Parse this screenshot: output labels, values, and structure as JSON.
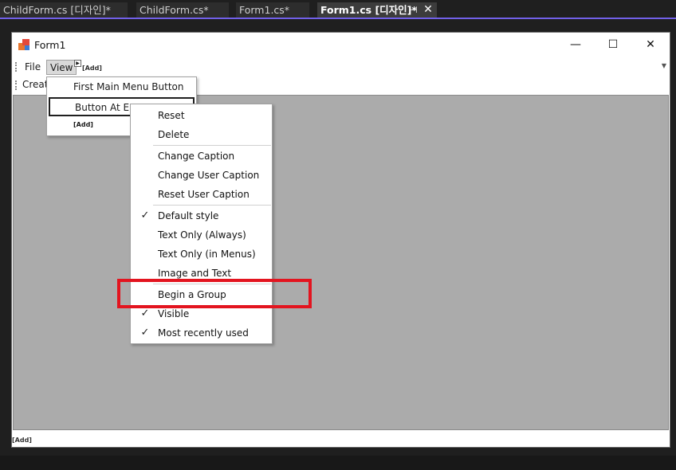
{
  "tabs": [
    {
      "label": "ChildForm.cs [디자인]*",
      "active": false
    },
    {
      "label": "ChildForm.cs*",
      "active": false
    },
    {
      "label": "Form1.cs*",
      "active": false
    },
    {
      "label": "Form1.cs [디자인]*",
      "active": true
    }
  ],
  "tab_pin_icon": "pin-icon",
  "tab_close_icon": "close-icon",
  "form": {
    "title": "Form1",
    "minimize": "—",
    "maximize": "☐",
    "close": "✕"
  },
  "menu": {
    "file": "File",
    "view": "View",
    "add": "[Add]"
  },
  "toolstrip_label": "Creat",
  "view_dropdown": [
    {
      "label": "First Main Menu Button"
    },
    {
      "label": "Button At En"
    },
    {
      "label": "[Add]"
    }
  ],
  "context_menu": [
    {
      "label": "Reset",
      "checked": false
    },
    {
      "label": "Delete",
      "checked": false
    },
    {
      "label": "Change Caption",
      "checked": false
    },
    {
      "label": "Change User Caption",
      "checked": false
    },
    {
      "label": "Reset User Caption",
      "checked": false
    },
    {
      "label": "Default style",
      "checked": true
    },
    {
      "label": "Text Only (Always)",
      "checked": false
    },
    {
      "label": "Text Only (in Menus)",
      "checked": false
    },
    {
      "label": "Image and Text",
      "checked": false
    },
    {
      "label": "Begin a Group",
      "checked": false
    },
    {
      "label": "Visible",
      "checked": true
    },
    {
      "label": "Most recently used",
      "checked": true
    }
  ],
  "check_mark": "✓",
  "status_add": "[Add]",
  "colors": {
    "accent": "#7160e8",
    "highlight": "#e3141f",
    "client_background": "#ababab"
  }
}
